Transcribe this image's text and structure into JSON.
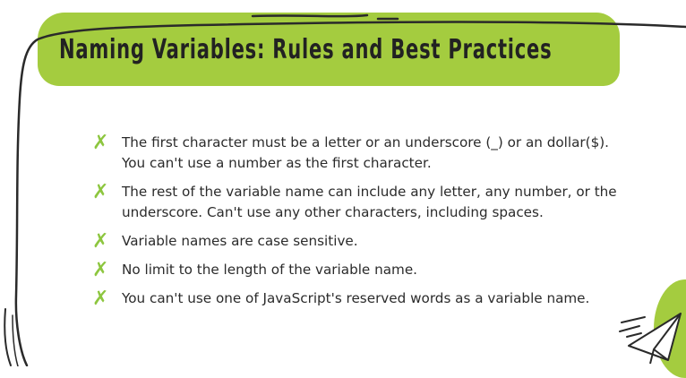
{
  "slide": {
    "title": "Naming Variables: Rules and Best Practices",
    "bullet_icon": "check-x-mark-icon",
    "accent_color": "#a4cc3f",
    "bullets": [
      "The first character must be a letter or an underscore (_) or an dollar($). You can't use a number as the first character.",
      "The rest of the variable name can include any letter, any number, or the underscore. Can't use any other characters, including spaces.",
      "Variable names are case sensitive.",
      "No limit to the length of the variable name.",
      "You can't use one of JavaScript's reserved words as a variable name."
    ]
  }
}
